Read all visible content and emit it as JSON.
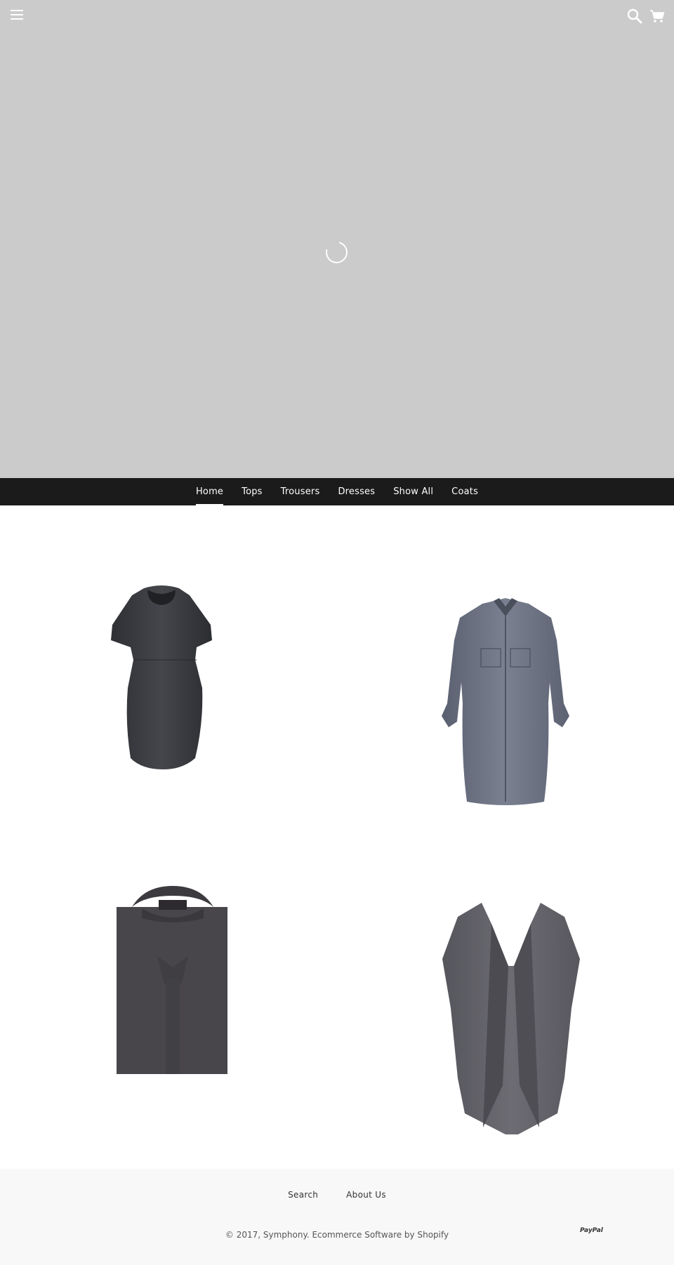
{
  "header": {
    "menu_icon": "hamburger-menu-icon",
    "search_icon": "search-icon",
    "cart_icon": "shopping-cart-icon",
    "loader_icon": "loading-spinner-icon",
    "hero_color": "#cbcbcb"
  },
  "nav": {
    "items": [
      {
        "label": "Home",
        "active": true
      },
      {
        "label": "Tops"
      },
      {
        "label": "Trousers"
      },
      {
        "label": "Dresses"
      },
      {
        "label": "Show All"
      },
      {
        "label": "Coats"
      }
    ],
    "background": "#1b1b1b"
  },
  "products": [
    {
      "image": "charcoal-short-sleeve-dress"
    },
    {
      "image": "grey-linen-shirt-dress"
    },
    {
      "image": "dark-grey-folded-shirt"
    },
    {
      "image": "grey-wool-waterfall-coat"
    }
  ],
  "footer": {
    "links": [
      "Search",
      "About Us"
    ],
    "copyright": "© 2017, Symphony. Ecommerce Software by Shopify",
    "payment": "PayPal"
  }
}
